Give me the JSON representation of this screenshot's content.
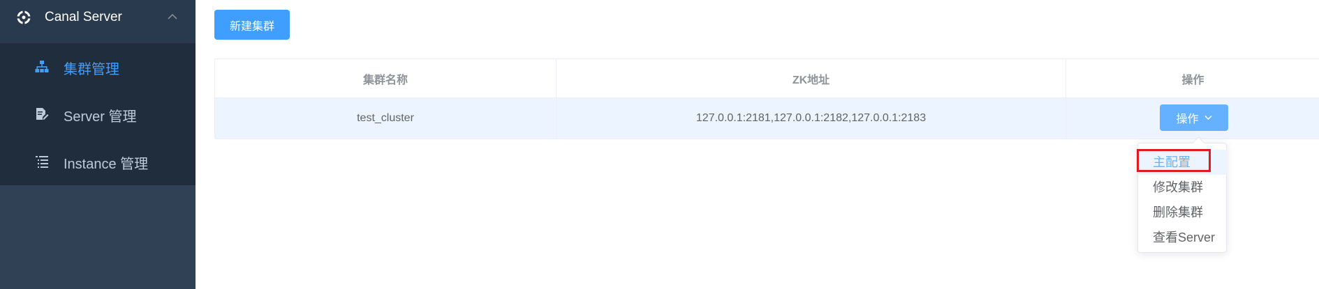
{
  "sidebar": {
    "title": "Canal Server",
    "title_icon": "canal-logo-icon",
    "collapse_icon": "chevron-up-icon",
    "items": [
      {
        "label": "集群管理",
        "icon": "sitemap-icon",
        "active": true
      },
      {
        "label": "Server 管理",
        "icon": "document-edit-icon",
        "active": false
      },
      {
        "label": "Instance 管理",
        "icon": "list-icon",
        "active": false
      }
    ],
    "colors": {
      "bg": "#304156",
      "submenu_bg": "#1f2d3d",
      "active": "#409eff",
      "text": "#bfcbd9"
    }
  },
  "toolbar": {
    "new_cluster_label": "新建集群"
  },
  "table": {
    "columns": [
      "集群名称",
      "ZK地址",
      "操作"
    ],
    "rows": [
      {
        "name": "test_cluster",
        "zk": "127.0.0.1:2181,127.0.0.1:2182,127.0.0.1:2183",
        "action_label": "操作"
      }
    ]
  },
  "dropdown": {
    "items": [
      "主配置",
      "修改集群",
      "删除集群",
      "查看Server"
    ],
    "hovered_index": 0
  },
  "accent": "#409eff"
}
